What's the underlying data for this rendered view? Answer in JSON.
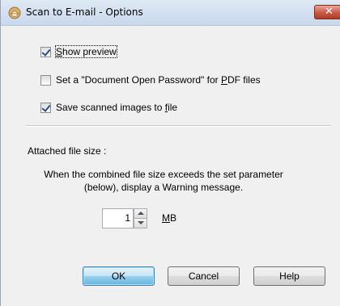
{
  "window": {
    "title": "Scan to E-mail - Options",
    "close_glyph": "✕"
  },
  "options": {
    "show_preview": {
      "pre": "",
      "mnemonic": "S",
      "post": "how preview",
      "checked": true
    },
    "doc_password": {
      "pre": "Set a \"Document Open Password\" for ",
      "mnemonic": "P",
      "post": "DF files",
      "checked": false
    },
    "save_images": {
      "pre": "Save scanned images to ",
      "mnemonic": "f",
      "post": "ile",
      "checked": true
    }
  },
  "attached": {
    "label": "Attached file size :",
    "description": "When the combined file size exceeds the set parameter (below), display a Warning message.",
    "value": "1",
    "unit_mnemonic": "M",
    "unit_rest": "B"
  },
  "buttons": {
    "ok": "OK",
    "cancel": "Cancel",
    "help": "Help"
  },
  "icons": {
    "app": "scanner-email-icon",
    "close": "close-icon",
    "spin_up": "spin-up-arrow-icon",
    "spin_down": "spin-down-arrow-icon"
  },
  "colors": {
    "close_button": "#c75a45",
    "default_button": "#98d1ef",
    "titlebar": "#dfe9f5",
    "dialog_bg": "#f0f0f0"
  }
}
